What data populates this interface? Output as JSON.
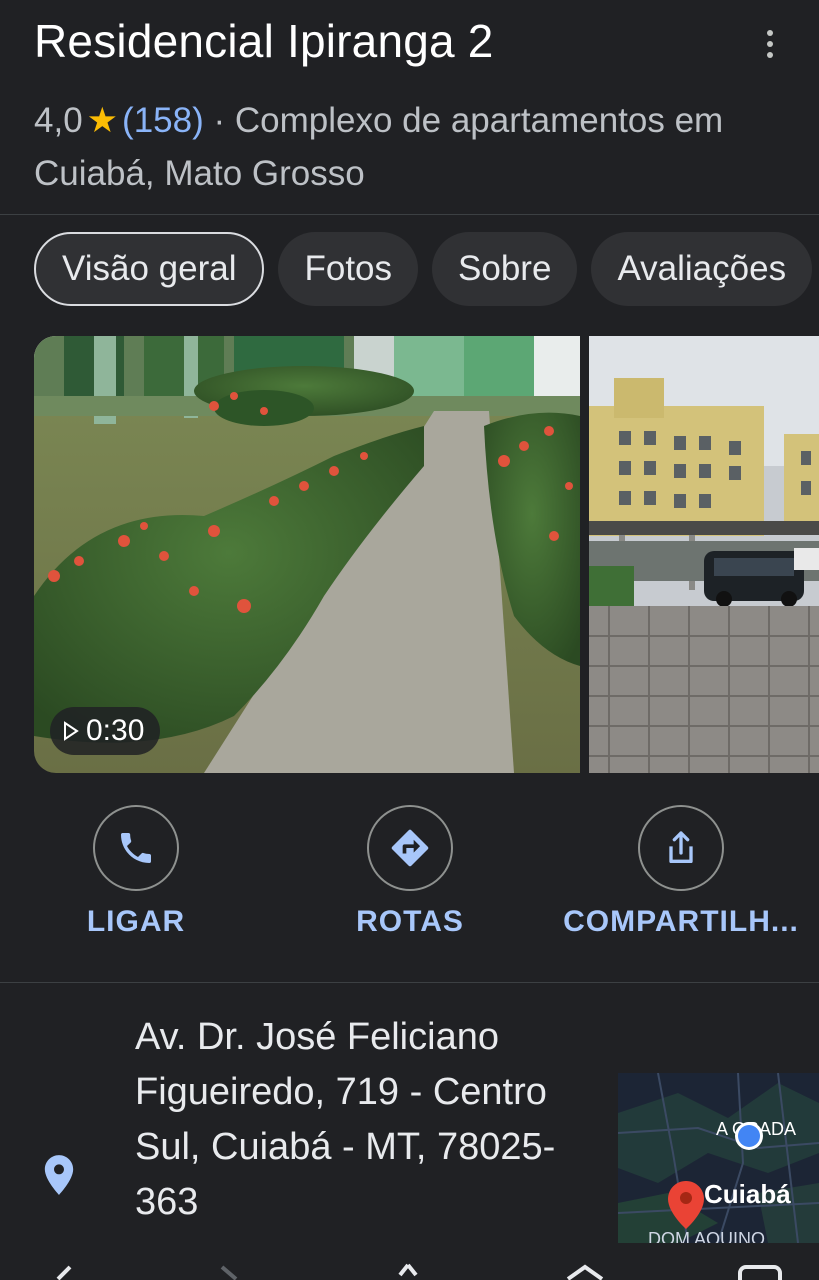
{
  "place": {
    "title": "Residencial Ipiranga 2",
    "rating": "4,0",
    "reviews": "(158)",
    "separator": "·",
    "category_line": "Complexo de apartamentos em Cuiabá, Mato Grosso"
  },
  "tabs": [
    {
      "label": "Visão geral",
      "active": true
    },
    {
      "label": "Fotos"
    },
    {
      "label": "Sobre"
    },
    {
      "label": "Avaliações"
    }
  ],
  "photos": {
    "video_duration": "0:30"
  },
  "actions": {
    "call": "LIGAR",
    "directions": "ROTAS",
    "share": "COMPARTILH..."
  },
  "address": {
    "text": "Av. Dr. José Feliciano Figueiredo, 719 - Centro Sul, Cuiabá - MT, 78025-363"
  },
  "map": {
    "city_label": "Cuiabá",
    "street_label_partial": "A  ORADA",
    "bottom_label_partial": "DOM AQUINO"
  },
  "colors": {
    "background": "#202124",
    "accent_link": "#8ab4f8",
    "action_label": "#a8c7fa",
    "star": "#fbbc04",
    "map_pin": "#ea4335",
    "location_dot": "#4285f4"
  }
}
